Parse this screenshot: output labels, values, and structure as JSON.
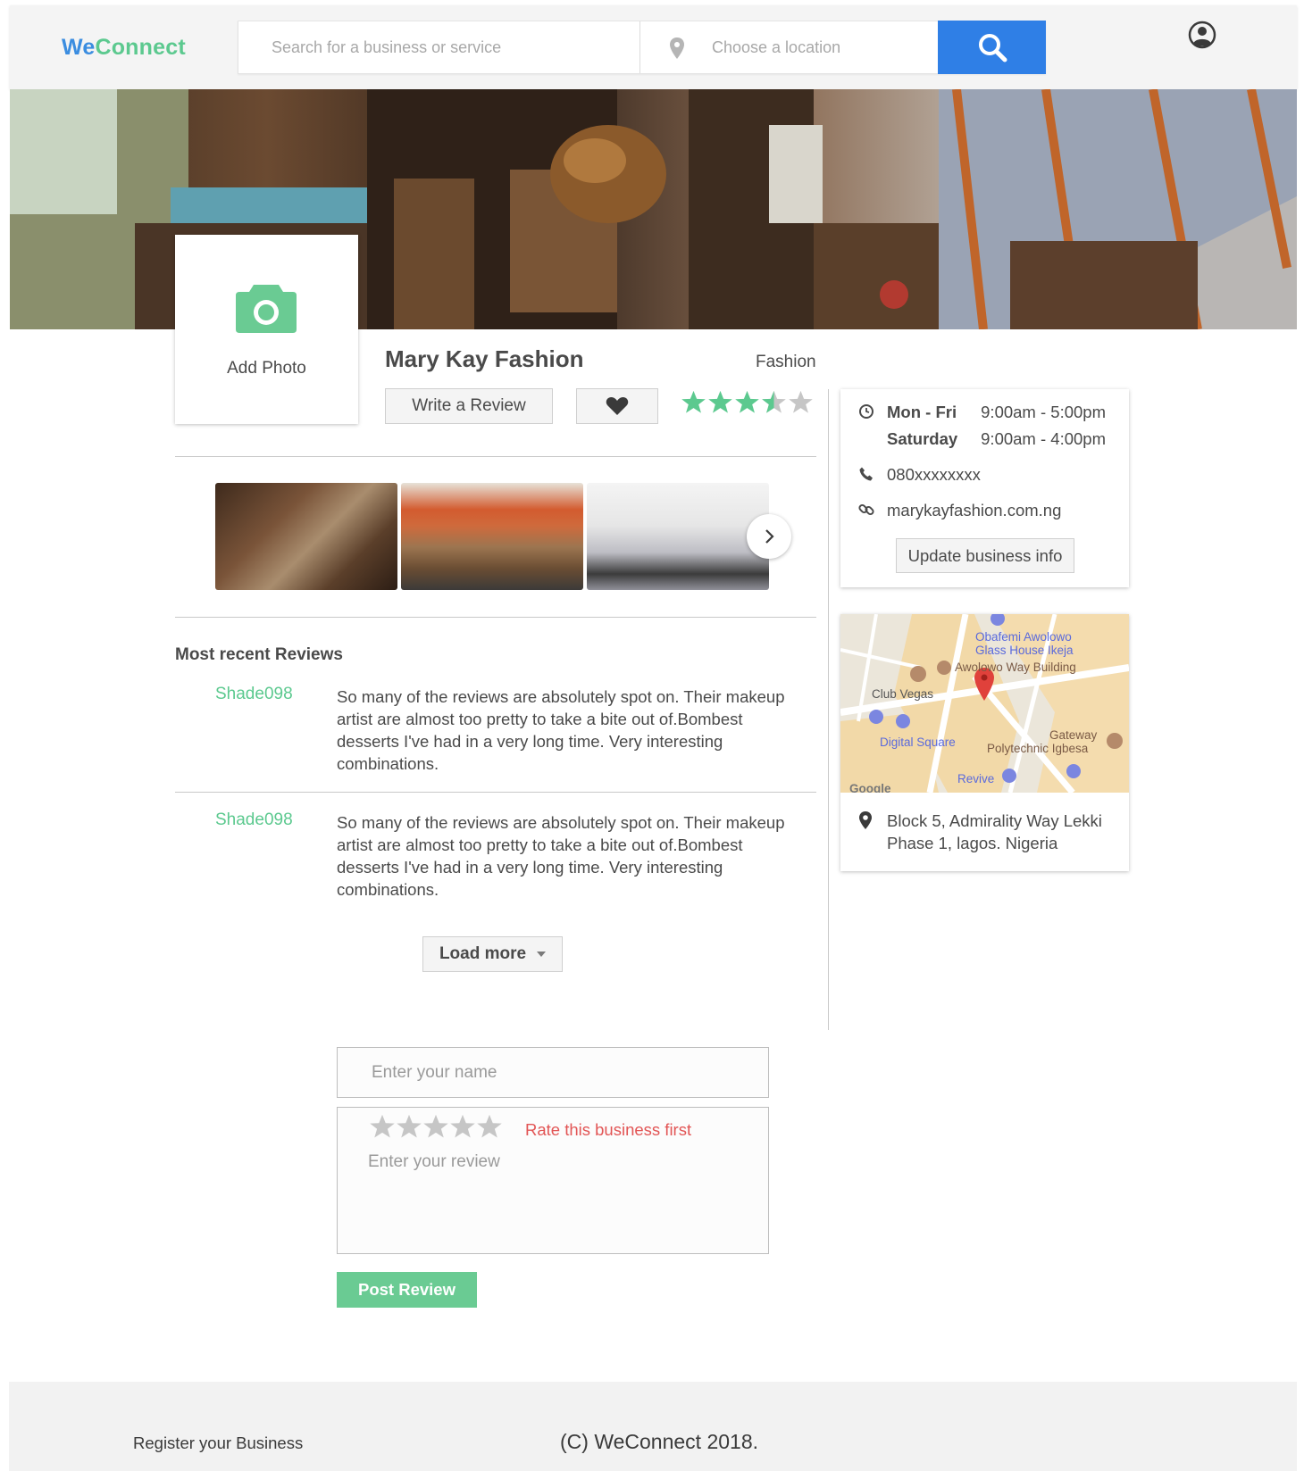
{
  "header": {
    "logo_we": "We",
    "logo_connect": "Connect",
    "search_placeholder": "Search for a business or service",
    "location_placeholder": "Choose a location"
  },
  "photo_card": {
    "label": "Add Photo"
  },
  "business": {
    "name": "Mary Kay Fashion",
    "category": "Fashion",
    "write_review_label": "Write a Review",
    "rating": 3.5,
    "rating_max": 5
  },
  "info": {
    "hours": [
      {
        "days": "Mon  -  Fri",
        "time": "9:00am  -  5:00pm"
      },
      {
        "days": "Saturday",
        "time": "9:00am  -  4:00pm"
      }
    ],
    "phone": "080xxxxxxxx",
    "website": "marykayfashion.com.ng",
    "update_label": "Update business info"
  },
  "map": {
    "labels": [
      "Obafemi Awolowo",
      "Glass House Ikeja",
      "Awolowo Way Building",
      "Club Vegas",
      "Digital Square",
      "Gateway",
      "Polytechnic Igbesa",
      "Revive",
      "Google"
    ],
    "address": "Block 5, Admirality Way Lekki Phase 1, lagos. Nigeria"
  },
  "reviews": {
    "title": "Most recent Reviews",
    "items": [
      {
        "user": "Shade098",
        "text": "So many of the reviews are absolutely spot on. Their makeup artist are almost too pretty to take a bite out of.Bombest desserts I've had in a very long time. Very interesting combinations."
      },
      {
        "user": "Shade098",
        "text": "So many of the reviews are absolutely spot on. Their makeup artist are almost too pretty to take a bite out of.Bombest desserts I've had in a very long time. Very interesting combinations."
      }
    ],
    "load_more_label": "Load more"
  },
  "form": {
    "name_placeholder": "Enter your name",
    "rate_warning": "Rate this business first",
    "review_placeholder": "Enter your review",
    "post_label": "Post Review"
  },
  "footer": {
    "register_label": "Register your Business",
    "copyright": "(C) WeConnect 2018."
  },
  "colors": {
    "brand_blue": "#2f7fe6",
    "brand_green": "#5cc98f",
    "warning_red": "#e25555",
    "star_green": "#5cc98f"
  }
}
